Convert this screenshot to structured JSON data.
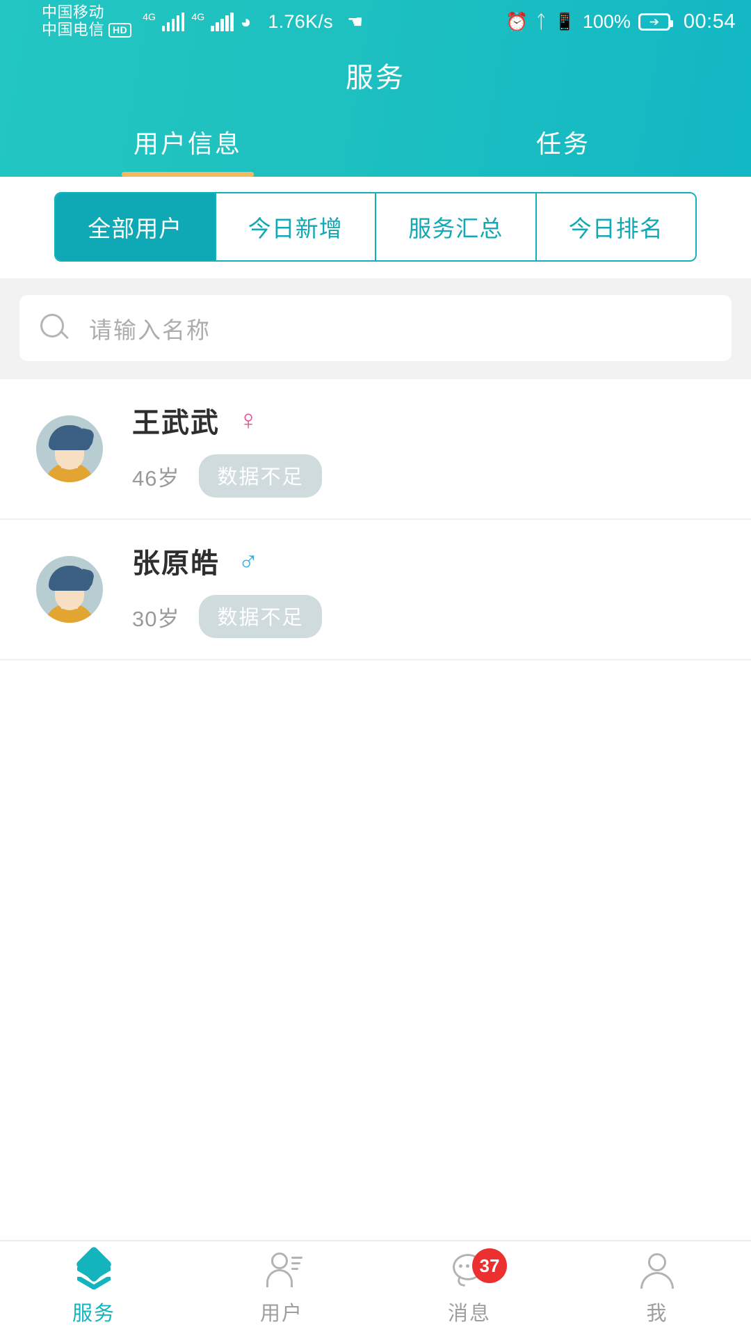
{
  "status_bar": {
    "carrier_primary": "中国移动",
    "carrier_secondary": "中国电信",
    "hd_label": "HD",
    "network_type_1": "4G",
    "network_type_2": "4G",
    "net_speed": "1.76K/s",
    "battery_percent": "100%",
    "time": "00:54",
    "icons": [
      "usb-icon",
      "alarm-icon",
      "bluetooth-icon",
      "vibrate-icon",
      "wifi-icon",
      "battery-charging-icon"
    ]
  },
  "header": {
    "title": "服务",
    "tabs": [
      {
        "label": "用户信息",
        "active": true
      },
      {
        "label": "任务",
        "active": false
      }
    ],
    "accent_color": "#1ec0c0",
    "indicator_color": "#f0b860"
  },
  "filters": {
    "options": [
      {
        "label": "全部用户",
        "active": true
      },
      {
        "label": "今日新增",
        "active": false
      },
      {
        "label": "服务汇总",
        "active": false
      },
      {
        "label": "今日排名",
        "active": false
      }
    ],
    "border_color": "#12b0bb",
    "active_bg": "#0fa9b5"
  },
  "search": {
    "placeholder": "请输入名称",
    "value": "",
    "icon": "search-icon"
  },
  "users": [
    {
      "name": "王武武",
      "gender": "female",
      "gender_symbol": "♀",
      "gender_color": "#ef4f91",
      "age": "46岁",
      "badge": "数据不足"
    },
    {
      "name": "张原皓",
      "gender": "male",
      "gender_symbol": "♂",
      "gender_color": "#3aaee0",
      "age": "30岁",
      "badge": "数据不足"
    }
  ],
  "bottom_nav": [
    {
      "label": "服务",
      "icon": "layers-icon",
      "active": true,
      "badge": ""
    },
    {
      "label": "用户",
      "icon": "person-list-icon",
      "active": false,
      "badge": ""
    },
    {
      "label": "消息",
      "icon": "chat-bubble-icon",
      "active": false,
      "badge": "37"
    },
    {
      "label": "我",
      "icon": "person-icon",
      "active": false,
      "badge": ""
    }
  ]
}
